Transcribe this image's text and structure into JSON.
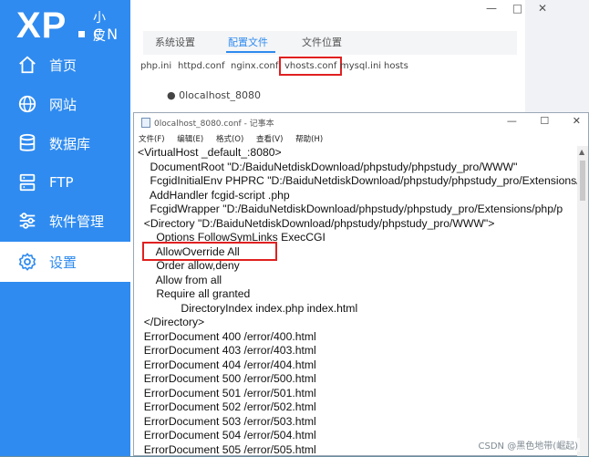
{
  "brand": {
    "logo_main": "XP",
    "logo_small": "小皮",
    "logo_cn": "CN"
  },
  "sidebar": {
    "items": [
      {
        "label": "首页",
        "icon": "home-icon"
      },
      {
        "label": "网站",
        "icon": "globe-icon"
      },
      {
        "label": "数据库",
        "icon": "database-icon"
      },
      {
        "label": "FTP",
        "icon": "server-icon"
      },
      {
        "label": "软件管理",
        "icon": "sliders-icon"
      },
      {
        "label": "设置",
        "icon": "gear-icon",
        "active": true
      }
    ]
  },
  "window_controls": {
    "min": "—",
    "max": "□",
    "close": "✕"
  },
  "tabs": [
    {
      "label": "系统设置"
    },
    {
      "label": "配置文件",
      "active": true
    },
    {
      "label": "文件位置"
    }
  ],
  "conf_files": [
    "php.ini",
    "httpd.conf",
    "nginx.conf",
    "vhosts.conf",
    "mysql.ini",
    "hosts"
  ],
  "selected_conf": "vhosts.conf",
  "site_item": "● 0localhost_8080",
  "notepad": {
    "title": "0localhost_8080.conf - 记事本",
    "controls": {
      "min": "—",
      "max": "☐",
      "close": "✕"
    },
    "menu": [
      "文件(F)",
      "编辑(E)",
      "格式(O)",
      "查看(V)",
      "帮助(H)"
    ],
    "lines": [
      "<VirtualHost _default_:8080>",
      "    DocumentRoot \"D:/BaiduNetdiskDownload/phpstudy/phpstudy_pro/WWW\"",
      "    FcgidInitialEnv PHPRC \"D:/BaiduNetdiskDownload/phpstudy/phpstudy_pro/Extensions/",
      "    AddHandler fcgid-script .php",
      "    FcgidWrapper \"D:/BaiduNetdiskDownload/phpstudy/phpstudy_pro/Extensions/php/p",
      "  <Directory \"D:/BaiduNetdiskDownload/phpstudy/phpstudy_pro/WWW\">",
      "      Options FollowSymLinks ExecCGI",
      "      AllowOverride All",
      "      Order allow,deny",
      "      Allow from all",
      "      Require all granted",
      "              DirectoryIndex index.php index.html",
      "  </Directory>",
      "  ErrorDocument 400 /error/400.html",
      "  ErrorDocument 403 /error/403.html",
      "  ErrorDocument 404 /error/404.html",
      "  ErrorDocument 500 /error/500.html",
      "  ErrorDocument 501 /error/501.html",
      "  ErrorDocument 502 /error/502.html",
      "  ErrorDocument 503 /error/503.html",
      "  ErrorDocument 504 /error/504.html",
      "  ErrorDocument 505 /error/505.html"
    ]
  },
  "watermark": "CSDN @黑色地带(崛起)",
  "colors": {
    "sidebar": "#2f8bf0",
    "accent": "#2f8bf0",
    "highlight": "#e02020"
  }
}
